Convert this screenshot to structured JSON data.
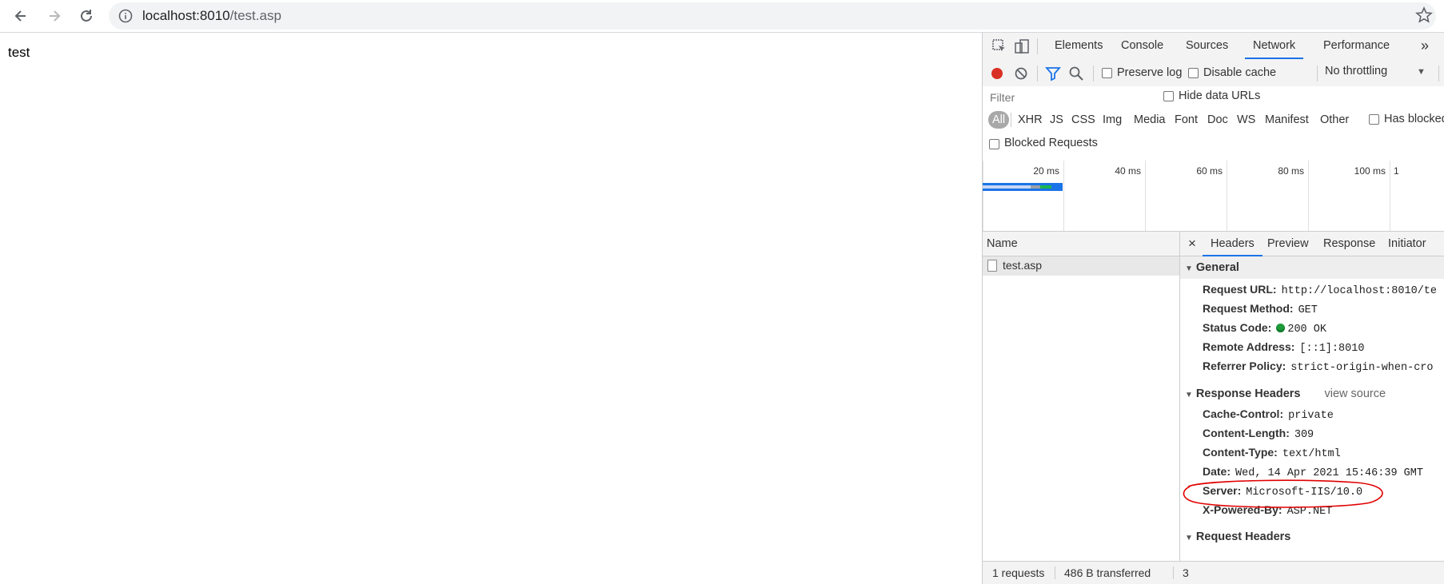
{
  "browser": {
    "url_host": "localhost:8010",
    "url_path": "/test.asp"
  },
  "page": {
    "body_text": "test"
  },
  "devtools": {
    "tabs": [
      "Elements",
      "Console",
      "Sources",
      "Network",
      "Performance"
    ],
    "active_tab": "Network",
    "more_tabs": "»",
    "toolbar": {
      "preserve_log": "Preserve log",
      "disable_cache": "Disable cache",
      "throttling": "No throttling"
    },
    "filter": {
      "placeholder": "Filter",
      "hide_data_urls": "Hide data URLs",
      "types": [
        "All",
        "XHR",
        "JS",
        "CSS",
        "Img",
        "Media",
        "Font",
        "Doc",
        "WS",
        "Manifest",
        "Other"
      ],
      "has_blocked": "Has blocked",
      "blocked_requests": "Blocked Requests"
    },
    "timeline": {
      "ticks": [
        "20 ms",
        "40 ms",
        "60 ms",
        "80 ms",
        "100 ms",
        "1"
      ]
    },
    "requests": {
      "name_header": "Name",
      "rows": [
        "test.asp"
      ]
    },
    "footer": {
      "requests": "1 requests",
      "transferred": "486 B transferred",
      "more": "3"
    },
    "detail": {
      "close": "×",
      "tabs": [
        "Headers",
        "Preview",
        "Response",
        "Initiator"
      ],
      "active_tab": "Headers",
      "general": {
        "title": "General",
        "request_url_label": "Request URL:",
        "request_url": "http://localhost:8010/te",
        "request_method_label": "Request Method:",
        "request_method": "GET",
        "status_code_label": "Status Code:",
        "status_code": "200 OK",
        "remote_address_label": "Remote Address:",
        "remote_address": "[::1]:8010",
        "referrer_policy_label": "Referrer Policy:",
        "referrer_policy": "strict-origin-when-cro"
      },
      "response_headers": {
        "title": "Response Headers",
        "view_source": "view source",
        "cache_control_label": "Cache-Control:",
        "cache_control": "private",
        "content_length_label": "Content-Length:",
        "content_length": "309",
        "content_type_label": "Content-Type:",
        "content_type": "text/html",
        "date_label": "Date:",
        "date": "Wed, 14 Apr 2021 15:46:39 GMT",
        "server_label": "Server:",
        "server": "Microsoft-IIS/10.0",
        "x_powered_by_label": "X-Powered-By:",
        "x_powered_by": "ASP.NET"
      },
      "request_headers": {
        "title": "Request Headers"
      }
    },
    "colors": {
      "accent": "#1a73e8",
      "record": "#d93025",
      "status_ok": "#1e9b3b",
      "highlight_annotation": "#e00000"
    }
  }
}
